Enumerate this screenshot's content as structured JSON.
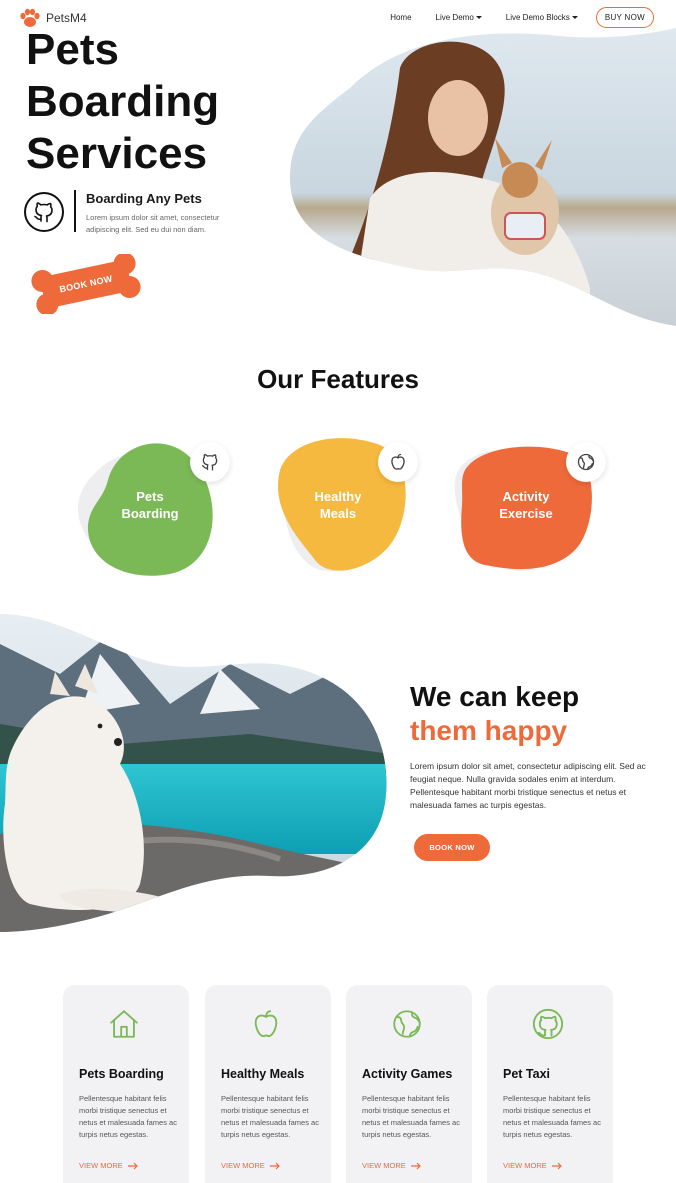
{
  "nav": {
    "logo_text": "PetsM4",
    "links": [
      {
        "label": "Home"
      },
      {
        "label": "Live Demo"
      },
      {
        "label": "Live Demo Blocks"
      }
    ],
    "buy_label": "BUY NOW"
  },
  "hero": {
    "title_lines": [
      "Pets",
      "Boarding",
      "Services"
    ],
    "feature_title": "Boarding Any Pets",
    "feature_text": "Lorem ipsum dolor sit amet, consectetur adipiscing elit. Sed eu dui non diam.",
    "book_label": "BOOK NOW"
  },
  "features": {
    "title": "Our Features",
    "items": [
      {
        "label_line1": "Pets",
        "label_line2": "Boarding",
        "icon": "github-icon",
        "color": "#7bb957"
      },
      {
        "label_line1": "Healthy",
        "label_line2": "Meals",
        "icon": "apple-icon",
        "color": "#f6b93f"
      },
      {
        "label_line1": "Activity",
        "label_line2": "Exercise",
        "icon": "globe-icon",
        "color": "#ee6a3a"
      }
    ]
  },
  "happy": {
    "title_line1": "We can keep",
    "title_line2": "them happy",
    "text": "Lorem ipsum dolor sit amet, consectetur adipiscing elit. Sed ac feugiat neque. Nulla gravida sodales enim at interdum. Pellentesque habitant morbi tristique senectus et netus et malesuada fames ac turpis egestas.",
    "book_label": "BOOK NOW"
  },
  "services": {
    "items": [
      {
        "title": "Pets Boarding",
        "text": "Pellentesque habitant felis morbi tristique senectus et netus et malesuada fames ac turpis netus egestas.",
        "link": "VIEW MORE",
        "icon": "home-icon"
      },
      {
        "title": "Healthy Meals",
        "text": "Pellentesque habitant felis morbi tristique senectus et netus et malesuada fames ac turpis netus egestas.",
        "link": "VIEW MORE",
        "icon": "apple-icon"
      },
      {
        "title": "Activity Games",
        "text": "Pellentesque habitant felis morbi tristique senectus et netus et malesuada fames ac turpis netus egestas.",
        "link": "VIEW MORE",
        "icon": "globe-icon"
      },
      {
        "title": "Pet Taxi",
        "text": "Pellentesque habitant felis morbi tristique senectus et netus et malesuada fames ac turpis netus egestas.",
        "link": "VIEW MORE",
        "icon": "github-icon"
      }
    ]
  },
  "colors": {
    "accent": "#ee6a3a",
    "green": "#7bb957",
    "yellow": "#f6b93f",
    "card_bg": "#f2f2f4"
  }
}
